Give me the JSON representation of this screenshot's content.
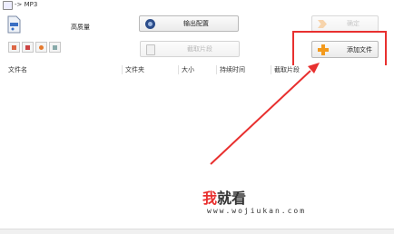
{
  "window": {
    "title": "-> MP3"
  },
  "toolbar": {
    "quality_label": "高质量",
    "output_config_label": "输出配置",
    "confirm_label": "确定",
    "clip_label": "截取片段",
    "add_file_label": "添加文件"
  },
  "table": {
    "columns": [
      "文件名",
      "文件夹",
      "大小",
      "持续时间",
      "截取片段"
    ]
  },
  "watermark": {
    "part1": "我",
    "part2": "就看",
    "url": "www.wojiukan.com"
  },
  "colors": {
    "highlight": "#e8302f",
    "add_icon": "#f39a1d",
    "output_icon": "#2c4d8a"
  },
  "icons": {
    "app": "app-icon",
    "quality": "mp3-file-icon",
    "output": "disc-icon",
    "confirm": "arrow-right-icon",
    "clip": "scissor-document-icon",
    "add": "plus-icon"
  }
}
